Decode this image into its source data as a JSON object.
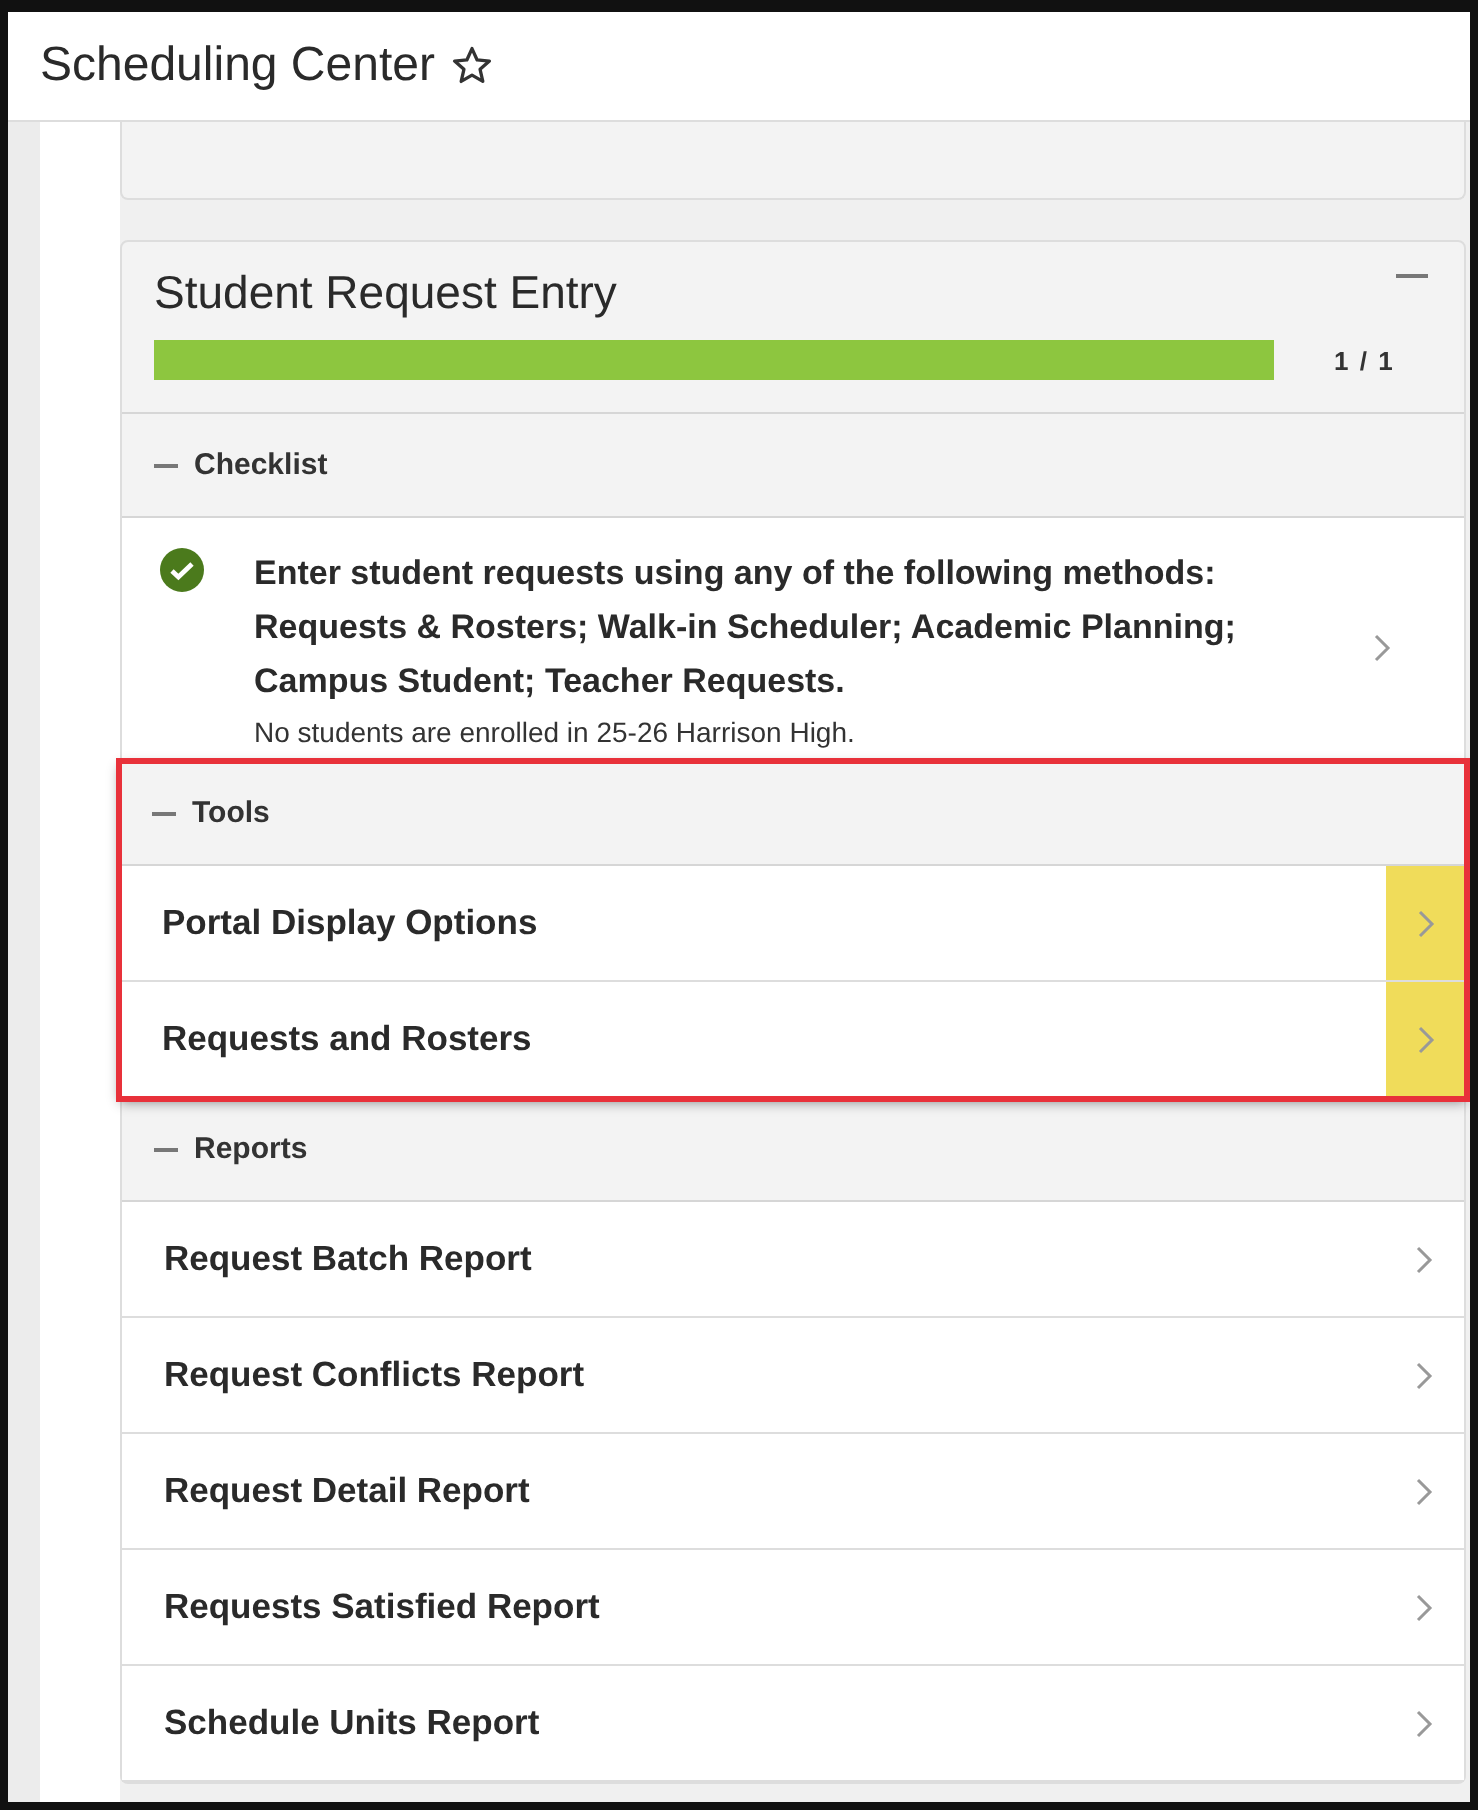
{
  "window": {
    "title": "Scheduling Center",
    "favorite": false
  },
  "panel": {
    "title": "Student Request Entry",
    "expanded": true,
    "progress": {
      "level": 1.0,
      "reading": "1 / 1"
    },
    "sections": [
      {
        "kind": "checklist",
        "title": "Checklist",
        "expanded": true,
        "highlighted": false,
        "items": [
          {
            "done": true,
            "text": "Enter student requests using any of the following methods: Requests & Rosters; Walk-in Scheduler; Academic Planning; Campus Student; Teacher Requests.",
            "note": "No students are enrolled in 25-26 Harrison High.",
            "highlighted": false
          }
        ]
      },
      {
        "kind": "links",
        "title": "Tools",
        "expanded": true,
        "highlighted": true,
        "items": [
          {
            "text": "Portal Display Options",
            "highlighted": true
          },
          {
            "text": "Requests and Rosters",
            "highlighted": true
          }
        ]
      },
      {
        "kind": "links",
        "title": "Reports",
        "expanded": true,
        "highlighted": false,
        "items": [
          {
            "text": "Request Batch Report",
            "highlighted": false
          },
          {
            "text": "Request Conflicts Report",
            "highlighted": false
          },
          {
            "text": "Request Detail Report",
            "highlighted": false
          },
          {
            "text": "Requests Satisfied Report",
            "highlighted": false
          },
          {
            "text": "Schedule Units Report",
            "highlighted": false
          }
        ]
      }
    ]
  }
}
